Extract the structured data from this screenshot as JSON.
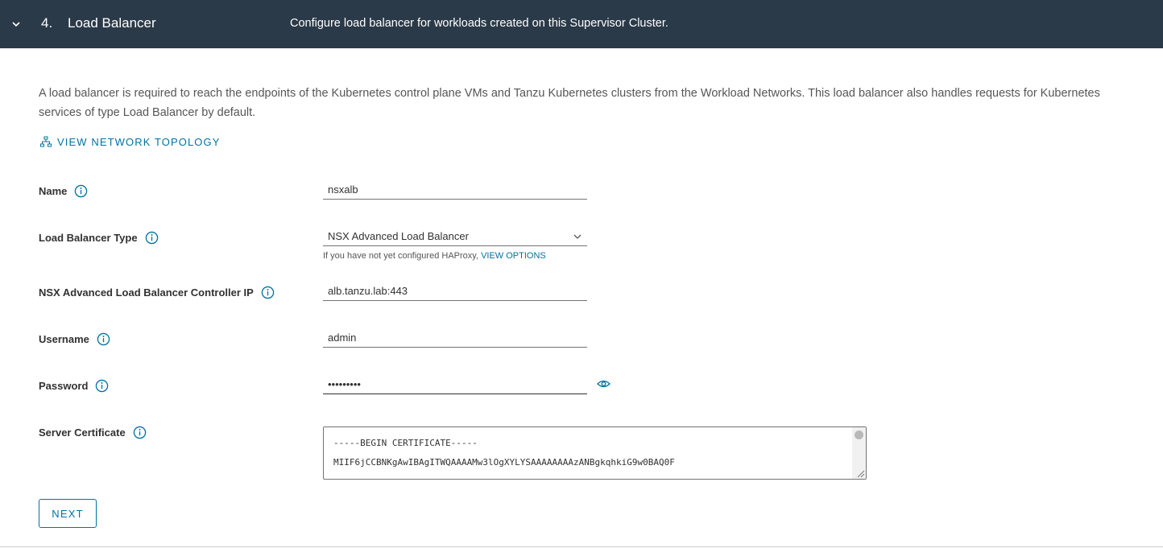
{
  "header": {
    "step_number": "4.",
    "step_title": "Load Balancer",
    "step_description": "Configure load balancer for workloads created on this Supervisor Cluster."
  },
  "description": {
    "line1": "A load balancer is required to reach the endpoints of the Kubernetes control plane VMs and Tanzu Kubernetes clusters from the Workload Networks. This load balancer also handles requests for Kubernetes",
    "line2": "services of type Load Balancer by default."
  },
  "topology_link": "VIEW NETWORK TOPOLOGY",
  "fields": {
    "name": {
      "label": "Name",
      "value": "nsxalb"
    },
    "lb_type": {
      "label": "Load Balancer Type",
      "value": "NSX Advanced Load Balancer",
      "helper_text": "If you have not yet configured HAProxy,",
      "helper_link": "VIEW OPTIONS"
    },
    "controller_ip": {
      "label": "NSX Advanced Load Balancer Controller IP",
      "value": "alb.tanzu.lab:443"
    },
    "username": {
      "label": "Username",
      "value": "admin"
    },
    "password": {
      "label": "Password",
      "value": "•••••••••"
    },
    "certificate": {
      "label": "Server Certificate",
      "line1": "-----BEGIN CERTIFICATE-----",
      "line2": "MIIF6jCCBNKgAwIBAgITWQAAAAMw3lOgXYLYSAAAAAAAAzANBgkqhkiG9w0BAQ0F"
    }
  },
  "next_button": "NEXT",
  "colors": {
    "header_bg": "#2b3a48",
    "accent": "#0072a3",
    "text": "#313131"
  }
}
